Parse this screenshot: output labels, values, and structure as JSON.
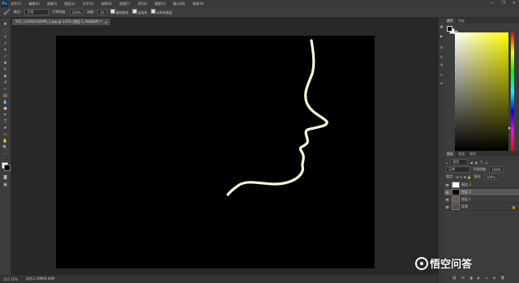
{
  "app": {
    "logo": "Ps"
  },
  "menu": [
    "文件(F)",
    "编辑(E)",
    "图像(I)",
    "图层(L)",
    "文字(Y)",
    "选择(S)",
    "滤镜(T)",
    "3D(D)",
    "视图(V)",
    "窗口(W)",
    "帮助(H)"
  ],
  "window_controls": [
    "—",
    "❐",
    "✕"
  ],
  "options": {
    "mode_label": "模式:",
    "mode_value": "正常",
    "opacity_label": "不透明度:",
    "opacity_value": "100%",
    "flow_label": "流量:",
    "flow_value": "50",
    "opt1": "清除锯齿",
    "opt2": "连续的",
    "opt3": "对所有图层"
  },
  "document": {
    "tab_title": "555_1129021020f0_1.jpg @ 115% (图层 2, RGB/8#) *"
  },
  "status": {
    "zoom": "115.11%",
    "doc_size": "文档:2.00M/6.46M"
  },
  "colors": {
    "canvas": "#000000",
    "stroke": "#fefbd6",
    "picker_hue": "#ffff00"
  },
  "right_panel": {
    "tabs": [
      "颜色",
      "色板"
    ],
    "layers_tabs": [
      "图层",
      "通道",
      "路径"
    ],
    "filter_label": "类型",
    "blend_mode": "正常",
    "opacity_label": "不透明度:",
    "opacity_value": "100%",
    "lock_label": "锁定:",
    "fill_label": "填充:",
    "fill_value": "100%",
    "layers": [
      {
        "name": "图层 3",
        "thumb": "#ffffff"
      },
      {
        "name": "图层 2",
        "thumb": "#000000"
      },
      {
        "name": "图层 1",
        "thumb": "#6a5a50"
      },
      {
        "name": "背景",
        "thumb": "#5a4a40"
      }
    ]
  },
  "watermark": {
    "text": "悟空问答"
  }
}
